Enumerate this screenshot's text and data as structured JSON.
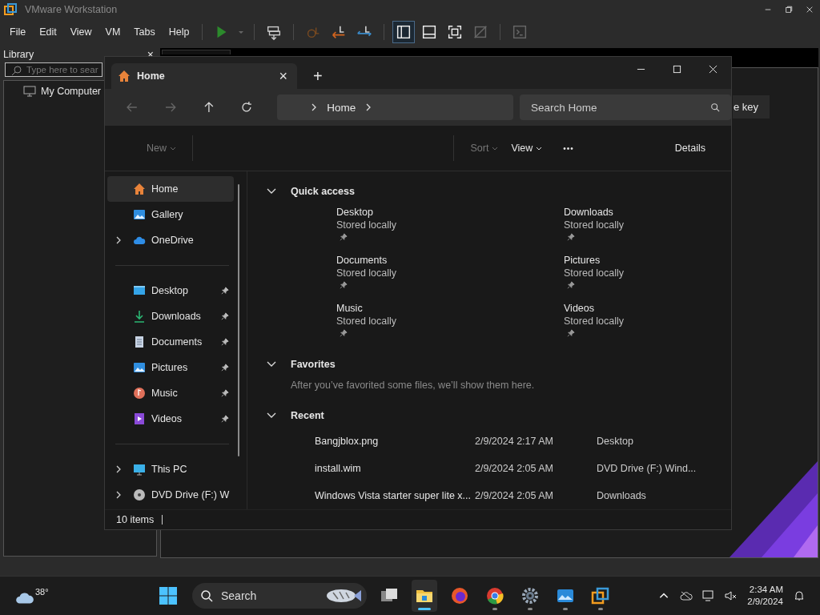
{
  "vmware": {
    "title": "VMware Workstation",
    "menu": [
      "File",
      "Edit",
      "View",
      "VM",
      "Tabs",
      "Help"
    ],
    "toolbar": [
      {
        "selected": false
      },
      {
        "selected": false
      },
      {
        "selected": false
      },
      {
        "selected": false
      },
      {
        "selected": false
      },
      {
        "selected": true
      },
      {
        "selected": false
      },
      {
        "selected": false
      },
      {
        "selected": false
      },
      {
        "selected": false
      }
    ],
    "library": {
      "title": "Library",
      "close": "×",
      "search": {
        "placeholder": "Type here to sear"
      },
      "items": [
        {
          "label": "My Computer"
        }
      ]
    },
    "partial_button": "e key"
  },
  "explorer": {
    "tab": {
      "title": "Home",
      "close": "×"
    },
    "new_tab": "+",
    "address": {
      "crumbs": [
        "Home"
      ]
    },
    "search": {
      "placeholder": "Search Home"
    },
    "commands": {
      "new": "New",
      "sort": "Sort",
      "view": "View",
      "more": "•••",
      "details": "Details"
    },
    "nav": [
      [
        {
          "label": "Home",
          "selected": true,
          "expandable": false,
          "pinned": false
        },
        {
          "label": "Gallery",
          "selected": false,
          "expandable": false,
          "pinned": false
        },
        {
          "label": "OneDrive",
          "selected": false,
          "expandable": true,
          "pinned": false
        }
      ],
      [
        {
          "label": "Desktop",
          "selected": false,
          "expandable": false,
          "pinned": true
        },
        {
          "label": "Downloads",
          "selected": false,
          "expandable": false,
          "pinned": true
        },
        {
          "label": "Documents",
          "selected": false,
          "expandable": false,
          "pinned": true
        },
        {
          "label": "Pictures",
          "selected": false,
          "expandable": false,
          "pinned": true
        },
        {
          "label": "Music",
          "selected": false,
          "expandable": false,
          "pinned": true
        },
        {
          "label": "Videos",
          "selected": false,
          "expandable": false,
          "pinned": true
        }
      ],
      [
        {
          "label": "This PC",
          "selected": false,
          "expandable": true,
          "pinned": false
        },
        {
          "label": "DVD Drive (F:) W",
          "selected": false,
          "expandable": true,
          "pinned": false
        }
      ]
    ],
    "quick_access": {
      "title": "Quick access",
      "expanded": true,
      "items": [
        {
          "name": "Desktop",
          "status": "Stored locally",
          "pinned": true
        },
        {
          "name": "Downloads",
          "status": "Stored locally",
          "pinned": true
        },
        {
          "name": "Documents",
          "status": "Stored locally",
          "pinned": true
        },
        {
          "name": "Pictures",
          "status": "Stored locally",
          "pinned": true
        },
        {
          "name": "Music",
          "status": "Stored locally",
          "pinned": true
        },
        {
          "name": "Videos",
          "status": "Stored locally",
          "pinned": true
        }
      ]
    },
    "favorites": {
      "title": "Favorites",
      "expanded": true,
      "message": "After you’ve favorited some files, we’ll show them here."
    },
    "recent": {
      "title": "Recent",
      "expanded": true,
      "rows": [
        {
          "name": "Bangjblox.png",
          "date": "2/9/2024 2:17 AM",
          "location": "Desktop"
        },
        {
          "name": "install.wim",
          "date": "2/9/2024 2:05 AM",
          "location": "DVD Drive (F:) Wind..."
        },
        {
          "name": "Windows Vista starter super lite x...",
          "date": "2/9/2024 2:05 AM",
          "location": "Downloads"
        }
      ]
    },
    "status": "10 items"
  },
  "taskbar": {
    "weather": "38°",
    "search": {
      "placeholder": "Search"
    },
    "apps": [
      {
        "selected": false,
        "running": false
      },
      {
        "selected": true,
        "running": true
      },
      {
        "selected": false,
        "running": false
      },
      {
        "selected": false,
        "running": true
      },
      {
        "selected": false,
        "running": true
      },
      {
        "selected": false,
        "running": true
      },
      {
        "selected": false,
        "running": true
      }
    ],
    "time": "2:34 AM",
    "date": "2/9/2024"
  }
}
